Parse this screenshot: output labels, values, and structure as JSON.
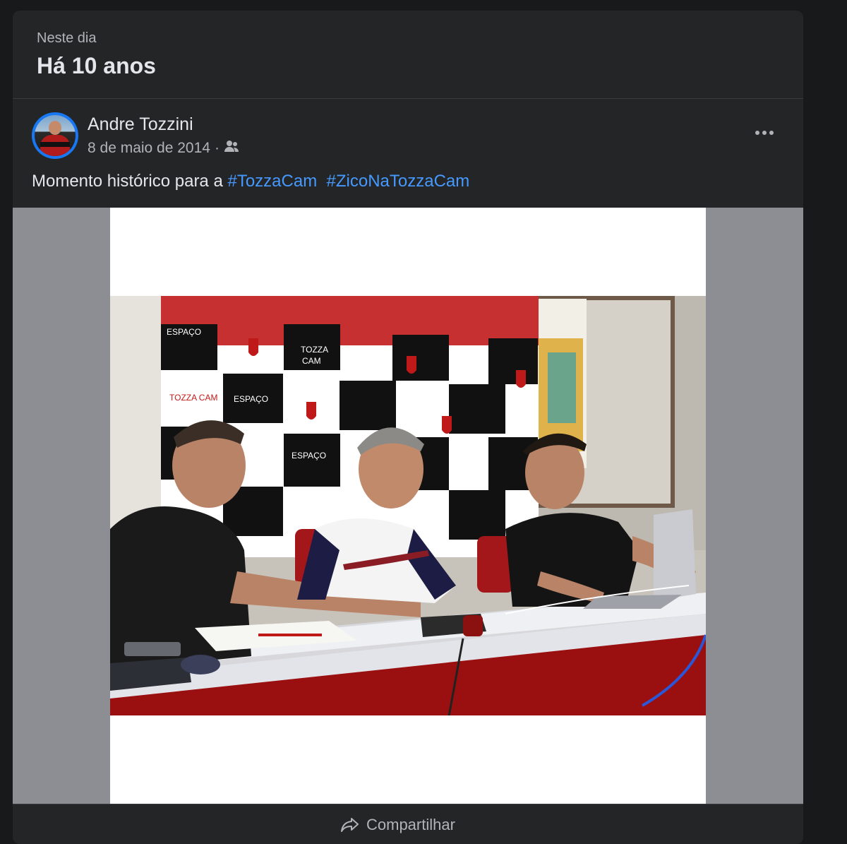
{
  "memory": {
    "section_label": "Neste dia",
    "title": "Há 10 anos"
  },
  "post": {
    "author": "Andre Tozzini",
    "date": "8 de maio de 2014",
    "separator": "·",
    "audience_icon": "friends-icon",
    "text_prefix": "Momento histórico para a ",
    "hashtags": [
      "#TozzaCam",
      "#ZicoNaTozzaCam"
    ],
    "more_icon": "more-options-icon"
  },
  "photo": {
    "backdrop_labels": [
      "ESPAÇO",
      "TOZZA",
      "CAM",
      "ESPAÇO",
      "TOZZA CAM",
      "ESPAÇO"
    ]
  },
  "actions": {
    "share_label": "Compartilhar",
    "share_icon": "share-icon"
  },
  "colors": {
    "background": "#18191a",
    "card": "#242526",
    "link": "#4599ff",
    "avatar_ring": "#1877f2"
  }
}
